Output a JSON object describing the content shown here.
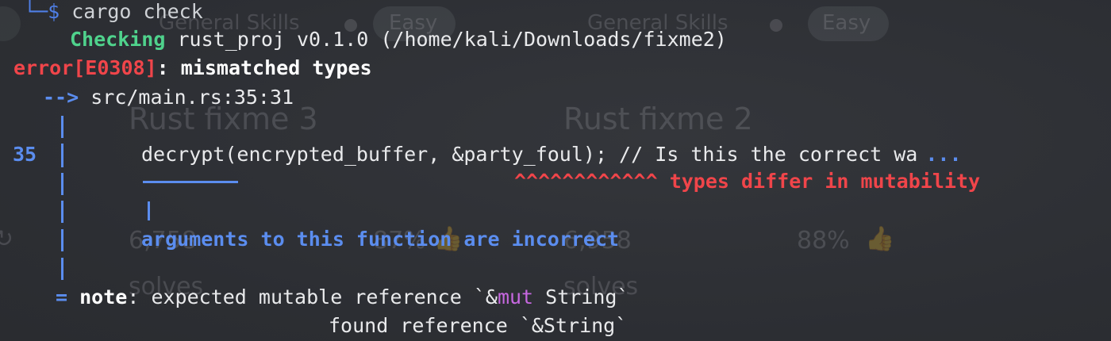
{
  "background_window": {
    "category_left": "General Skills",
    "difficulty_left": "Easy",
    "category_right": "General Skills",
    "difficulty_right": "Easy",
    "title_left": "Rust fixme 3",
    "title_right": "Rust fixme 2",
    "solves_count_left": "6,758",
    "rating_left": "87%",
    "solves_count_right": "6,958",
    "rating_right": "88%",
    "solves_label_left": "solves",
    "solves_label_right": "solves"
  },
  "terminal": {
    "prompt_branch": "└─$",
    "command": "cargo check",
    "checking_label": "Checking",
    "checking_target": "rust_proj v0.1.0 (/home/kali/Downloads/fixme2)",
    "error_code": "error[E0308]",
    "error_sep": ":",
    "error_message": "mismatched types",
    "location_arrow": "-->",
    "location": "src/main.rs:35:31",
    "line_number": "35",
    "code_line": "decrypt(encrypted_buffer, &party_foul); // Is this the correct wa",
    "code_ellipsis": "...",
    "carets": "^^^^^^^^^^^^",
    "caret_label": "types differ in mutability",
    "secondary_pipe": "|",
    "secondary_label": "arguments to this function are incorrect",
    "note_equals": "=",
    "note_label": "note",
    "note_text_1": ": expected mutable reference `&",
    "note_mut": "mut",
    "note_text_2": " String`",
    "note_found": "found reference `&String`"
  },
  "colors": {
    "background": "#2f3135",
    "blue": "#5b8def",
    "green": "#4fd28c",
    "red": "#f0454a",
    "purple": "#c768e0",
    "text": "#e9eaec"
  }
}
